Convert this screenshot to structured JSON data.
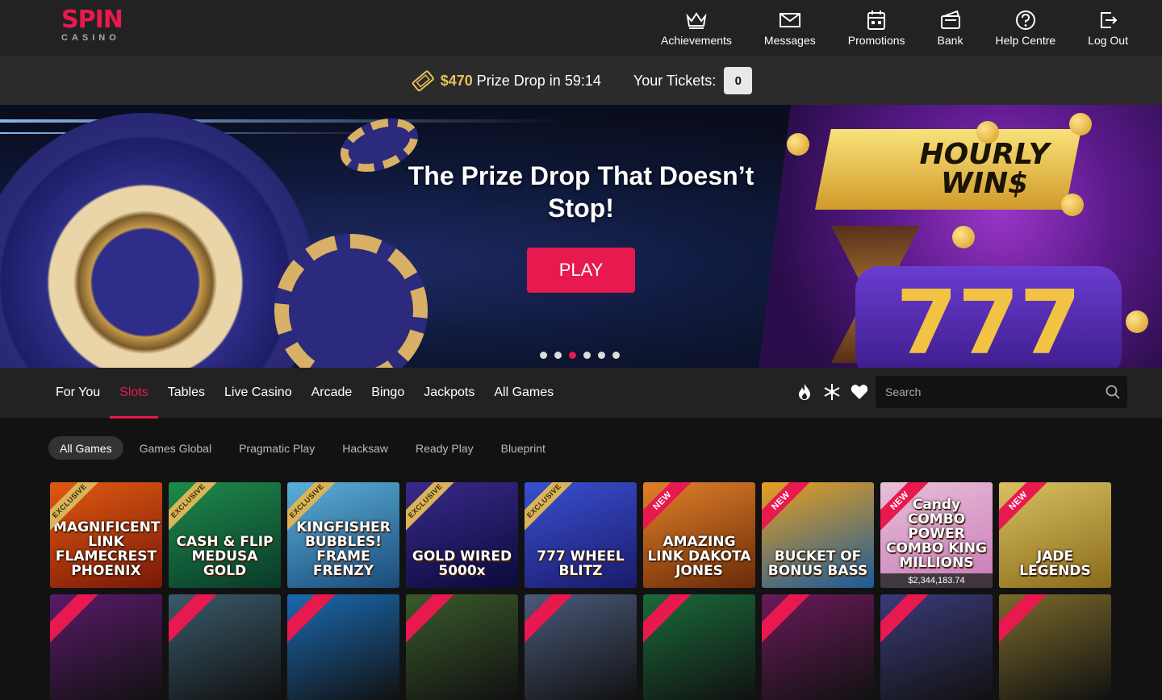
{
  "logo": {
    "brand": "SPIN",
    "sub": "CASINO"
  },
  "nav": [
    {
      "label": "Achievements",
      "icon": "crown-icon"
    },
    {
      "label": "Messages",
      "icon": "envelope-icon"
    },
    {
      "label": "Promotions",
      "icon": "calendar-icon"
    },
    {
      "label": "Bank",
      "icon": "wallet-icon"
    },
    {
      "label": "Help Centre",
      "icon": "question-icon"
    },
    {
      "label": "Log Out",
      "icon": "logout-icon"
    }
  ],
  "prize_drop": {
    "amount": "$470",
    "text": "Prize Drop in 59:14",
    "tickets_label": "Your Tickets:",
    "tickets_count": "0"
  },
  "hero": {
    "title": "The Prize Drop That Doesn’t Stop!",
    "play_label": "PLAY",
    "badge_text": "HOURLY WIN$",
    "reel_text": "777",
    "active_slide": 3,
    "slide_count": 6
  },
  "categories": [
    "For You",
    "Slots",
    "Tables",
    "Live Casino",
    "Arcade",
    "Bingo",
    "Jackpots",
    "All Games"
  ],
  "active_category": "Slots",
  "category_icons": [
    "fire-icon",
    "snowflake-icon",
    "heart-icon"
  ],
  "search": {
    "placeholder": "Search"
  },
  "providers": [
    "All Games",
    "Games Global",
    "Pragmatic Play",
    "Hacksaw",
    "Ready Play",
    "Blueprint"
  ],
  "active_provider": "All Games",
  "games": [
    {
      "title": "MAGNIFICENT LINK FLAMECREST PHOENIX",
      "badge": "EXCLUSIVE",
      "color1": "#7a1808",
      "color2": "#e05a10"
    },
    {
      "title": "CASH & FLIP MEDUSA GOLD",
      "badge": "EXCLUSIVE",
      "color1": "#0a3a2a",
      "color2": "#1d8a4a"
    },
    {
      "title": "KINGFISHER BUBBLES! FRAME FRENZY",
      "badge": "EXCLUSIVE",
      "color1": "#1a4a7a",
      "color2": "#5ab0d8"
    },
    {
      "title": "GOLD WIRED 5000x",
      "badge": "EXCLUSIVE",
      "color1": "#0a0a3a",
      "color2": "#3a2a8a"
    },
    {
      "title": "777 WHEEL BLITZ",
      "badge": "EXCLUSIVE",
      "color1": "#1a1a6a",
      "color2": "#3a50d0"
    },
    {
      "title": "AMAZING LINK DAKOTA JONES",
      "badge": "NEW",
      "color1": "#6a2a08",
      "color2": "#e0802a"
    },
    {
      "title": "BUCKET OF BONUS BASS",
      "badge": "NEW",
      "color1": "#1a5a9a",
      "color2": "#e8a020"
    },
    {
      "title": "Candy COMBO POWER COMBO KING MILLIONS",
      "badge": "NEW",
      "color1": "#c87ab8",
      "color2": "#e8c0d8",
      "jackpot": "$2,344,183.74"
    },
    {
      "title": "JADE LEGENDS",
      "badge": "NEW",
      "color1": "#8a6a1a",
      "color2": "#d8c060"
    }
  ],
  "games_row2_colors": [
    "#5a1a6a",
    "#3a5a6a",
    "#1a6ab0",
    "#3a5a2a",
    "#4a5a7a",
    "#1a6a3a",
    "#6a1a5a",
    "#3a3a7a",
    "#7a6a2a"
  ],
  "colors": {
    "accent": "#e8194e",
    "gold": "#e6c15b",
    "bg": "#121212",
    "bar": "#222222"
  }
}
